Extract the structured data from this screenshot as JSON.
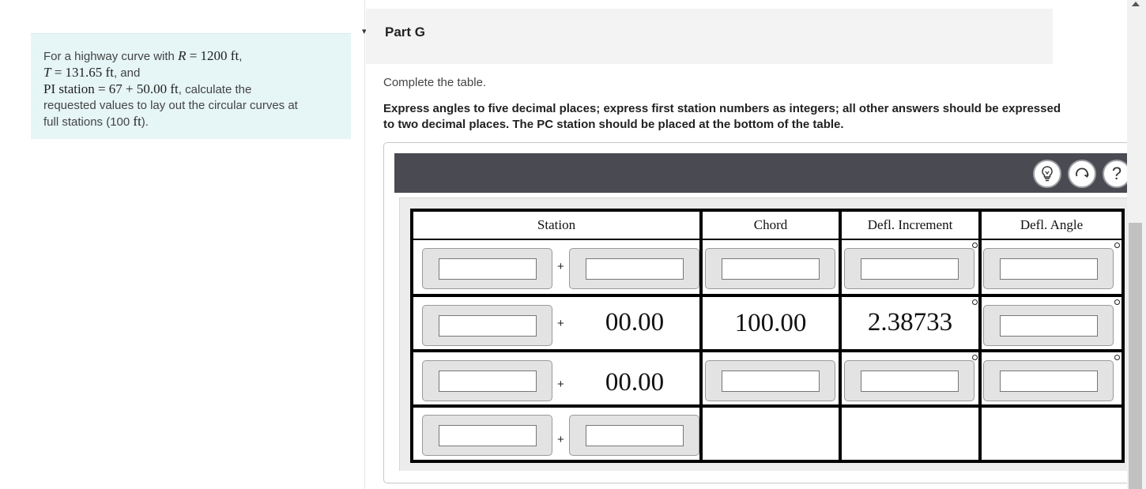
{
  "problem": {
    "line1_pre": "For a highway curve with ",
    "line1_var": "R",
    "line1_eq": " = 1200 ft",
    "line1_post": ",",
    "line2_var": "T",
    "line2_eq": " = 131.65 ft",
    "line2_post": ", and",
    "line3_math": "PI station = 67 + 50.00 ft",
    "line3_post": ", calculate the",
    "line4": "requested values to lay out the circular curves at",
    "line5_pre": "full stations (100 ",
    "line5_unit": "ft",
    "line5_post": ")."
  },
  "part": {
    "caret": "▾",
    "title": "Part G"
  },
  "instructions": {
    "plain": "Complete the table.",
    "bold": "Express angles to five decimal places; express first station numbers as integers; all other answers should be expressed to two decimal places. The PC station should be placed at the bottom of the table."
  },
  "toolbar": {
    "hint_icon": "lightbulb-icon",
    "reset_icon": "reset-icon",
    "help_label": "?"
  },
  "table": {
    "headers": [
      "Station",
      "Chord",
      "Defl. Increment",
      "Defl. Angle"
    ],
    "plus": "+",
    "rows": [
      {
        "station_int": "",
        "station_dec": "",
        "chord": "",
        "defl_increment": "",
        "defl_angle": ""
      },
      {
        "station_int": "",
        "station_dec": "00.00",
        "chord": "100.00",
        "defl_increment": "2.38733",
        "defl_angle": ""
      },
      {
        "station_int": "",
        "station_dec": "00.00",
        "chord": "",
        "defl_increment": "",
        "defl_angle": ""
      },
      {
        "station_int": "",
        "station_dec": ""
      }
    ]
  },
  "colors": {
    "problem_bg": "#e6f5f6",
    "toolbar_bg": "#4a4b52"
  }
}
